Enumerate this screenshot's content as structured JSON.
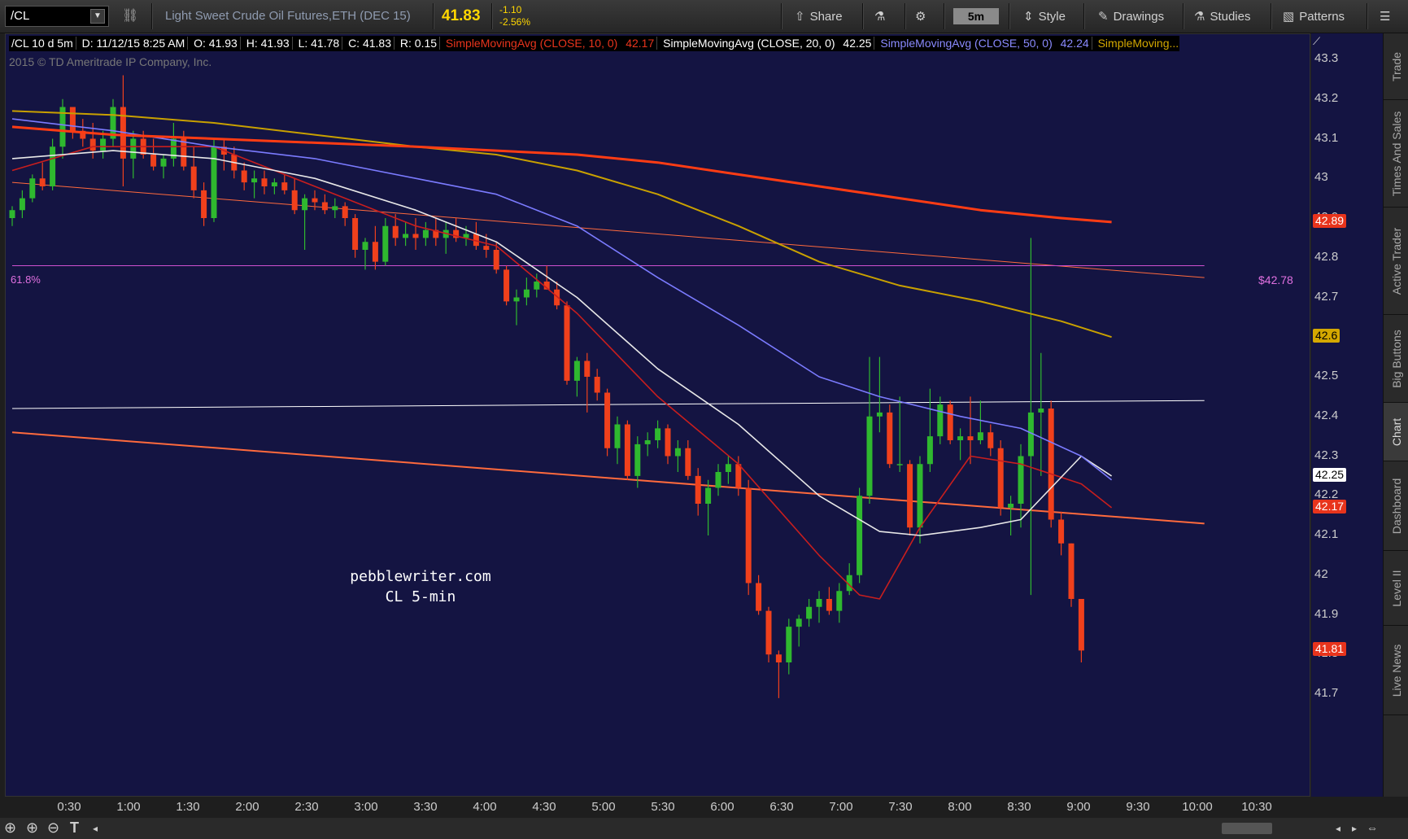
{
  "toolbar": {
    "symbol": "/CL",
    "description": "Light Sweet Crude Oil Futures,ETH (DEC 15)",
    "last_price": "41.83",
    "change": "-1.10",
    "change_pct": "-2.56%",
    "share": "Share",
    "timeframe": "5m",
    "style": "Style",
    "drawings": "Drawings",
    "studies": "Studies",
    "patterns": "Patterns"
  },
  "header": {
    "symbol_period": "/CL 10 d 5m",
    "date": "D: 11/12/15 8:25 AM",
    "open": "O: 41.93",
    "high": "H: 41.93",
    "low": "L: 41.78",
    "close": "C: 41.83",
    "range": "R: 0.15",
    "sma10_label": "SimpleMovingAvg (CLOSE, 10, 0)",
    "sma10_value": "42.17",
    "sma20_label": "SimpleMovingAvg (CLOSE, 20, 0)",
    "sma20_value": "42.25",
    "sma50_label": "SimpleMovingAvg (CLOSE, 50, 0)",
    "sma50_value": "42.24",
    "sma_more_label": "SimpleMoving..."
  },
  "copyright": "2015 © TD Ameritrade IP Company, Inc.",
  "fib": {
    "label": "61.8%",
    "price": "$42.78"
  },
  "watermark": {
    "line1": "pebblewriter.com",
    "line2": "CL 5-min"
  },
  "price_axis": {
    "ticks": [
      "43.3",
      "43.2",
      "43.1",
      "43",
      "42.9",
      "42.8",
      "42.7",
      "42.6",
      "42.5",
      "42.4",
      "42.3",
      "42.2",
      "42.1",
      "42",
      "41.9",
      "41.8",
      "41.7"
    ],
    "badges": [
      {
        "text": "42.89",
        "bg": "#e8341c",
        "fg": "#ffffff",
        "value": 42.89
      },
      {
        "text": "42.6",
        "bg": "#d4a800",
        "fg": "#000000",
        "value": 42.6
      },
      {
        "text": "42.25",
        "bg": "#ffffff",
        "fg": "#000000",
        "value": 42.25
      },
      {
        "text": "42.17",
        "bg": "#e8341c",
        "fg": "#ffffff",
        "value": 42.17
      },
      {
        "text": "41.81",
        "bg": "#e8341c",
        "fg": "#ffffff",
        "value": 41.81
      }
    ]
  },
  "time_axis": [
    "0:30",
    "1:00",
    "1:30",
    "2:00",
    "2:30",
    "3:00",
    "3:30",
    "4:00",
    "4:30",
    "5:00",
    "5:30",
    "6:00",
    "6:30",
    "7:00",
    "7:30",
    "8:00",
    "8:30",
    "9:00",
    "9:30",
    "10:00",
    "10:30"
  ],
  "right_tabs": [
    "Trade",
    "Times And Sales",
    "Active Trader",
    "Big Buttons",
    "Chart",
    "Dashboard",
    "Level II",
    "Live News"
  ],
  "colors": {
    "up": "#2fb82f",
    "down": "#f0401c",
    "sma10": "#c81e1e",
    "sma20": "#e8e8e8",
    "sma50": "#7b7bff",
    "sma100": "#c8a000",
    "sma200": "#ff3c14",
    "fib": "#d050d0",
    "background": "#141442"
  },
  "chart_data": {
    "type": "candlestick",
    "ylim": [
      41.62,
      43.36
    ],
    "candles": [
      [
        42.9,
        42.93,
        42.88,
        42.92
      ],
      [
        42.92,
        42.97,
        42.9,
        42.95
      ],
      [
        42.95,
        43.01,
        42.94,
        43.0
      ],
      [
        43.0,
        43.04,
        42.97,
        42.98
      ],
      [
        42.98,
        43.1,
        42.97,
        43.08
      ],
      [
        43.08,
        43.2,
        43.05,
        43.18
      ],
      [
        43.18,
        43.18,
        43.1,
        43.12
      ],
      [
        43.12,
        43.15,
        43.08,
        43.1
      ],
      [
        43.1,
        43.14,
        43.05,
        43.07
      ],
      [
        43.07,
        43.12,
        43.05,
        43.1
      ],
      [
        43.1,
        43.2,
        43.08,
        43.18
      ],
      [
        43.18,
        43.26,
        42.98,
        43.05
      ],
      [
        43.05,
        43.12,
        43.0,
        43.1
      ],
      [
        43.1,
        43.12,
        43.05,
        43.06
      ],
      [
        43.06,
        43.1,
        43.02,
        43.03
      ],
      [
        43.03,
        43.06,
        43.0,
        43.05
      ],
      [
        43.05,
        43.14,
        43.03,
        43.1
      ],
      [
        43.1,
        43.12,
        43.02,
        43.03
      ],
      [
        43.03,
        43.08,
        42.95,
        42.97
      ],
      [
        42.97,
        42.99,
        42.88,
        42.9
      ],
      [
        42.9,
        43.1,
        42.89,
        43.08
      ],
      [
        43.08,
        43.1,
        43.02,
        43.06
      ],
      [
        43.06,
        43.08,
        43.0,
        43.02
      ],
      [
        43.02,
        43.04,
        42.97,
        42.99
      ],
      [
        42.99,
        43.02,
        42.95,
        43.0
      ],
      [
        43.0,
        43.02,
        42.96,
        42.98
      ],
      [
        42.98,
        43.0,
        42.96,
        42.99
      ],
      [
        42.99,
        43.01,
        42.96,
        42.97
      ],
      [
        42.97,
        43.0,
        42.91,
        42.92
      ],
      [
        42.92,
        42.96,
        42.82,
        42.95
      ],
      [
        42.95,
        42.97,
        42.92,
        42.94
      ],
      [
        42.94,
        42.96,
        42.91,
        42.92
      ],
      [
        42.92,
        42.95,
        42.9,
        42.93
      ],
      [
        42.93,
        42.94,
        42.88,
        42.9
      ],
      [
        42.9,
        42.91,
        42.8,
        42.82
      ],
      [
        42.82,
        42.85,
        42.77,
        42.84
      ],
      [
        42.84,
        42.88,
        42.77,
        42.79
      ],
      [
        42.79,
        42.9,
        42.78,
        42.88
      ],
      [
        42.88,
        42.91,
        42.83,
        42.85
      ],
      [
        42.85,
        42.89,
        42.83,
        42.86
      ],
      [
        42.86,
        42.9,
        42.82,
        42.85
      ],
      [
        42.85,
        42.89,
        42.83,
        42.87
      ],
      [
        42.87,
        42.9,
        42.83,
        42.85
      ],
      [
        42.85,
        42.89,
        42.81,
        42.87
      ],
      [
        42.87,
        42.9,
        42.84,
        42.85
      ],
      [
        42.85,
        42.88,
        42.83,
        42.86
      ],
      [
        42.86,
        42.89,
        42.82,
        42.83
      ],
      [
        42.83,
        42.86,
        42.8,
        42.82
      ],
      [
        42.82,
        42.84,
        42.76,
        42.77
      ],
      [
        42.77,
        42.78,
        42.68,
        42.69
      ],
      [
        42.69,
        42.72,
        42.63,
        42.7
      ],
      [
        42.7,
        42.75,
        42.68,
        42.72
      ],
      [
        42.72,
        42.76,
        42.7,
        42.74
      ],
      [
        42.74,
        42.78,
        42.72,
        42.72
      ],
      [
        42.72,
        42.74,
        42.67,
        42.68
      ],
      [
        42.68,
        42.69,
        42.48,
        42.49
      ],
      [
        42.49,
        42.55,
        42.45,
        42.54
      ],
      [
        42.54,
        42.56,
        42.41,
        42.5
      ],
      [
        42.5,
        42.52,
        42.44,
        42.46
      ],
      [
        42.46,
        42.47,
        42.3,
        42.32
      ],
      [
        42.32,
        42.4,
        42.28,
        42.38
      ],
      [
        42.38,
        42.39,
        42.24,
        42.25
      ],
      [
        42.25,
        42.35,
        42.22,
        42.33
      ],
      [
        42.33,
        42.36,
        42.3,
        42.34
      ],
      [
        42.34,
        42.39,
        42.32,
        42.37
      ],
      [
        42.37,
        42.38,
        42.28,
        42.3
      ],
      [
        42.3,
        42.34,
        42.26,
        42.32
      ],
      [
        42.32,
        42.34,
        42.24,
        42.25
      ],
      [
        42.25,
        42.27,
        42.15,
        42.18
      ],
      [
        42.18,
        42.24,
        42.1,
        42.22
      ],
      [
        42.22,
        42.28,
        42.2,
        42.26
      ],
      [
        42.26,
        42.3,
        42.23,
        42.28
      ],
      [
        42.28,
        42.3,
        42.2,
        42.22
      ],
      [
        42.22,
        42.24,
        41.95,
        41.98
      ],
      [
        41.98,
        42.0,
        41.9,
        41.91
      ],
      [
        41.91,
        41.92,
        41.78,
        41.8
      ],
      [
        41.8,
        41.81,
        41.69,
        41.78
      ],
      [
        41.78,
        41.89,
        41.75,
        41.87
      ],
      [
        41.87,
        41.9,
        41.82,
        41.89
      ],
      [
        41.89,
        41.94,
        41.87,
        41.92
      ],
      [
        41.92,
        41.96,
        41.88,
        41.94
      ],
      [
        41.94,
        41.97,
        41.9,
        41.91
      ],
      [
        41.91,
        41.98,
        41.88,
        41.96
      ],
      [
        41.96,
        42.03,
        41.95,
        42.0
      ],
      [
        42.0,
        42.22,
        41.98,
        42.2
      ],
      [
        42.2,
        42.55,
        42.18,
        42.4
      ],
      [
        42.4,
        42.55,
        42.36,
        42.41
      ],
      [
        42.41,
        42.43,
        42.27,
        42.28
      ],
      [
        42.28,
        42.45,
        42.26,
        42.28
      ],
      [
        42.28,
        42.29,
        42.1,
        42.12
      ],
      [
        42.12,
        42.3,
        42.08,
        42.28
      ],
      [
        42.28,
        42.47,
        42.26,
        42.35
      ],
      [
        42.35,
        42.45,
        42.33,
        42.43
      ],
      [
        42.43,
        42.44,
        42.33,
        42.34
      ],
      [
        42.34,
        42.37,
        42.29,
        42.35
      ],
      [
        42.35,
        42.45,
        42.28,
        42.34
      ],
      [
        42.34,
        42.44,
        42.33,
        42.36
      ],
      [
        42.36,
        42.38,
        42.3,
        42.32
      ],
      [
        42.32,
        42.34,
        42.15,
        42.17
      ],
      [
        42.17,
        42.2,
        42.1,
        42.18
      ],
      [
        42.18,
        42.33,
        42.12,
        42.3
      ],
      [
        42.3,
        42.85,
        41.95,
        42.41
      ],
      [
        42.41,
        42.56,
        42.25,
        42.42
      ],
      [
        42.42,
        42.44,
        42.12,
        42.14
      ],
      [
        42.14,
        42.16,
        42.05,
        42.08
      ],
      [
        42.08,
        42.08,
        41.92,
        41.94
      ],
      [
        41.94,
        41.94,
        41.78,
        41.81
      ]
    ],
    "sma_lines": [
      {
        "name": "SMA 10",
        "color": "#c81e1e",
        "points": [
          [
            0,
            43.02
          ],
          [
            8,
            43.08
          ],
          [
            20,
            43.08
          ],
          [
            30,
            42.98
          ],
          [
            40,
            42.88
          ],
          [
            48,
            42.83
          ],
          [
            56,
            42.66
          ],
          [
            64,
            42.45
          ],
          [
            72,
            42.28
          ],
          [
            80,
            42.05
          ],
          [
            84,
            41.95
          ],
          [
            86,
            41.94
          ],
          [
            90,
            42.12
          ],
          [
            95,
            42.3
          ],
          [
            100,
            42.28
          ],
          [
            106,
            42.23
          ],
          [
            109,
            42.17
          ]
        ]
      },
      {
        "name": "SMA 20",
        "color": "#e8e8e8",
        "points": [
          [
            0,
            43.05
          ],
          [
            10,
            43.07
          ],
          [
            20,
            43.05
          ],
          [
            30,
            43.0
          ],
          [
            40,
            42.92
          ],
          [
            48,
            42.84
          ],
          [
            56,
            42.7
          ],
          [
            64,
            42.52
          ],
          [
            72,
            42.38
          ],
          [
            80,
            42.2
          ],
          [
            86,
            42.11
          ],
          [
            90,
            42.1
          ],
          [
            96,
            42.12
          ],
          [
            100,
            42.14
          ],
          [
            106,
            42.3
          ],
          [
            109,
            42.25
          ]
        ]
      },
      {
        "name": "SMA 50",
        "color": "#7b7bff",
        "points": [
          [
            0,
            43.15
          ],
          [
            10,
            43.12
          ],
          [
            20,
            43.08
          ],
          [
            30,
            43.05
          ],
          [
            40,
            43.0
          ],
          [
            48,
            42.96
          ],
          [
            56,
            42.88
          ],
          [
            64,
            42.75
          ],
          [
            72,
            42.63
          ],
          [
            80,
            42.5
          ],
          [
            86,
            42.45
          ],
          [
            94,
            42.4
          ],
          [
            100,
            42.37
          ],
          [
            106,
            42.3
          ],
          [
            109,
            42.24
          ]
        ]
      },
      {
        "name": "SMA 100",
        "color": "#c8a000",
        "points": [
          [
            0,
            43.17
          ],
          [
            10,
            43.16
          ],
          [
            20,
            43.14
          ],
          [
            30,
            43.11
          ],
          [
            40,
            43.08
          ],
          [
            48,
            43.06
          ],
          [
            56,
            43.02
          ],
          [
            64,
            42.96
          ],
          [
            72,
            42.88
          ],
          [
            80,
            42.79
          ],
          [
            88,
            42.73
          ],
          [
            96,
            42.69
          ],
          [
            104,
            42.64
          ],
          [
            109,
            42.6
          ]
        ]
      },
      {
        "name": "SMA 200",
        "color": "#ff3c14",
        "points": [
          [
            0,
            43.13
          ],
          [
            10,
            43.11
          ],
          [
            20,
            43.1
          ],
          [
            30,
            43.09
          ],
          [
            40,
            43.08
          ],
          [
            48,
            43.07
          ],
          [
            56,
            43.06
          ],
          [
            64,
            43.04
          ],
          [
            72,
            43.01
          ],
          [
            80,
            42.98
          ],
          [
            88,
            42.95
          ],
          [
            96,
            42.92
          ],
          [
            104,
            42.9
          ],
          [
            109,
            42.89
          ]
        ]
      }
    ],
    "trendlines": [
      {
        "color": "#ff6a3d",
        "width": 2,
        "from": [
          0,
          42.36
        ],
        "to": [
          118.2,
          42.13
        ]
      },
      {
        "color": "#ff6a3d",
        "width": 1,
        "from": [
          0,
          42.99
        ],
        "to": [
          118.2,
          42.75
        ]
      },
      {
        "color": "#ffffff",
        "width": 1,
        "from": [
          0,
          42.42
        ],
        "to": [
          118.2,
          42.44
        ]
      },
      {
        "color": "#d050d0",
        "width": 1,
        "from": [
          0,
          42.78
        ],
        "to": [
          118.2,
          42.78
        ]
      }
    ]
  }
}
